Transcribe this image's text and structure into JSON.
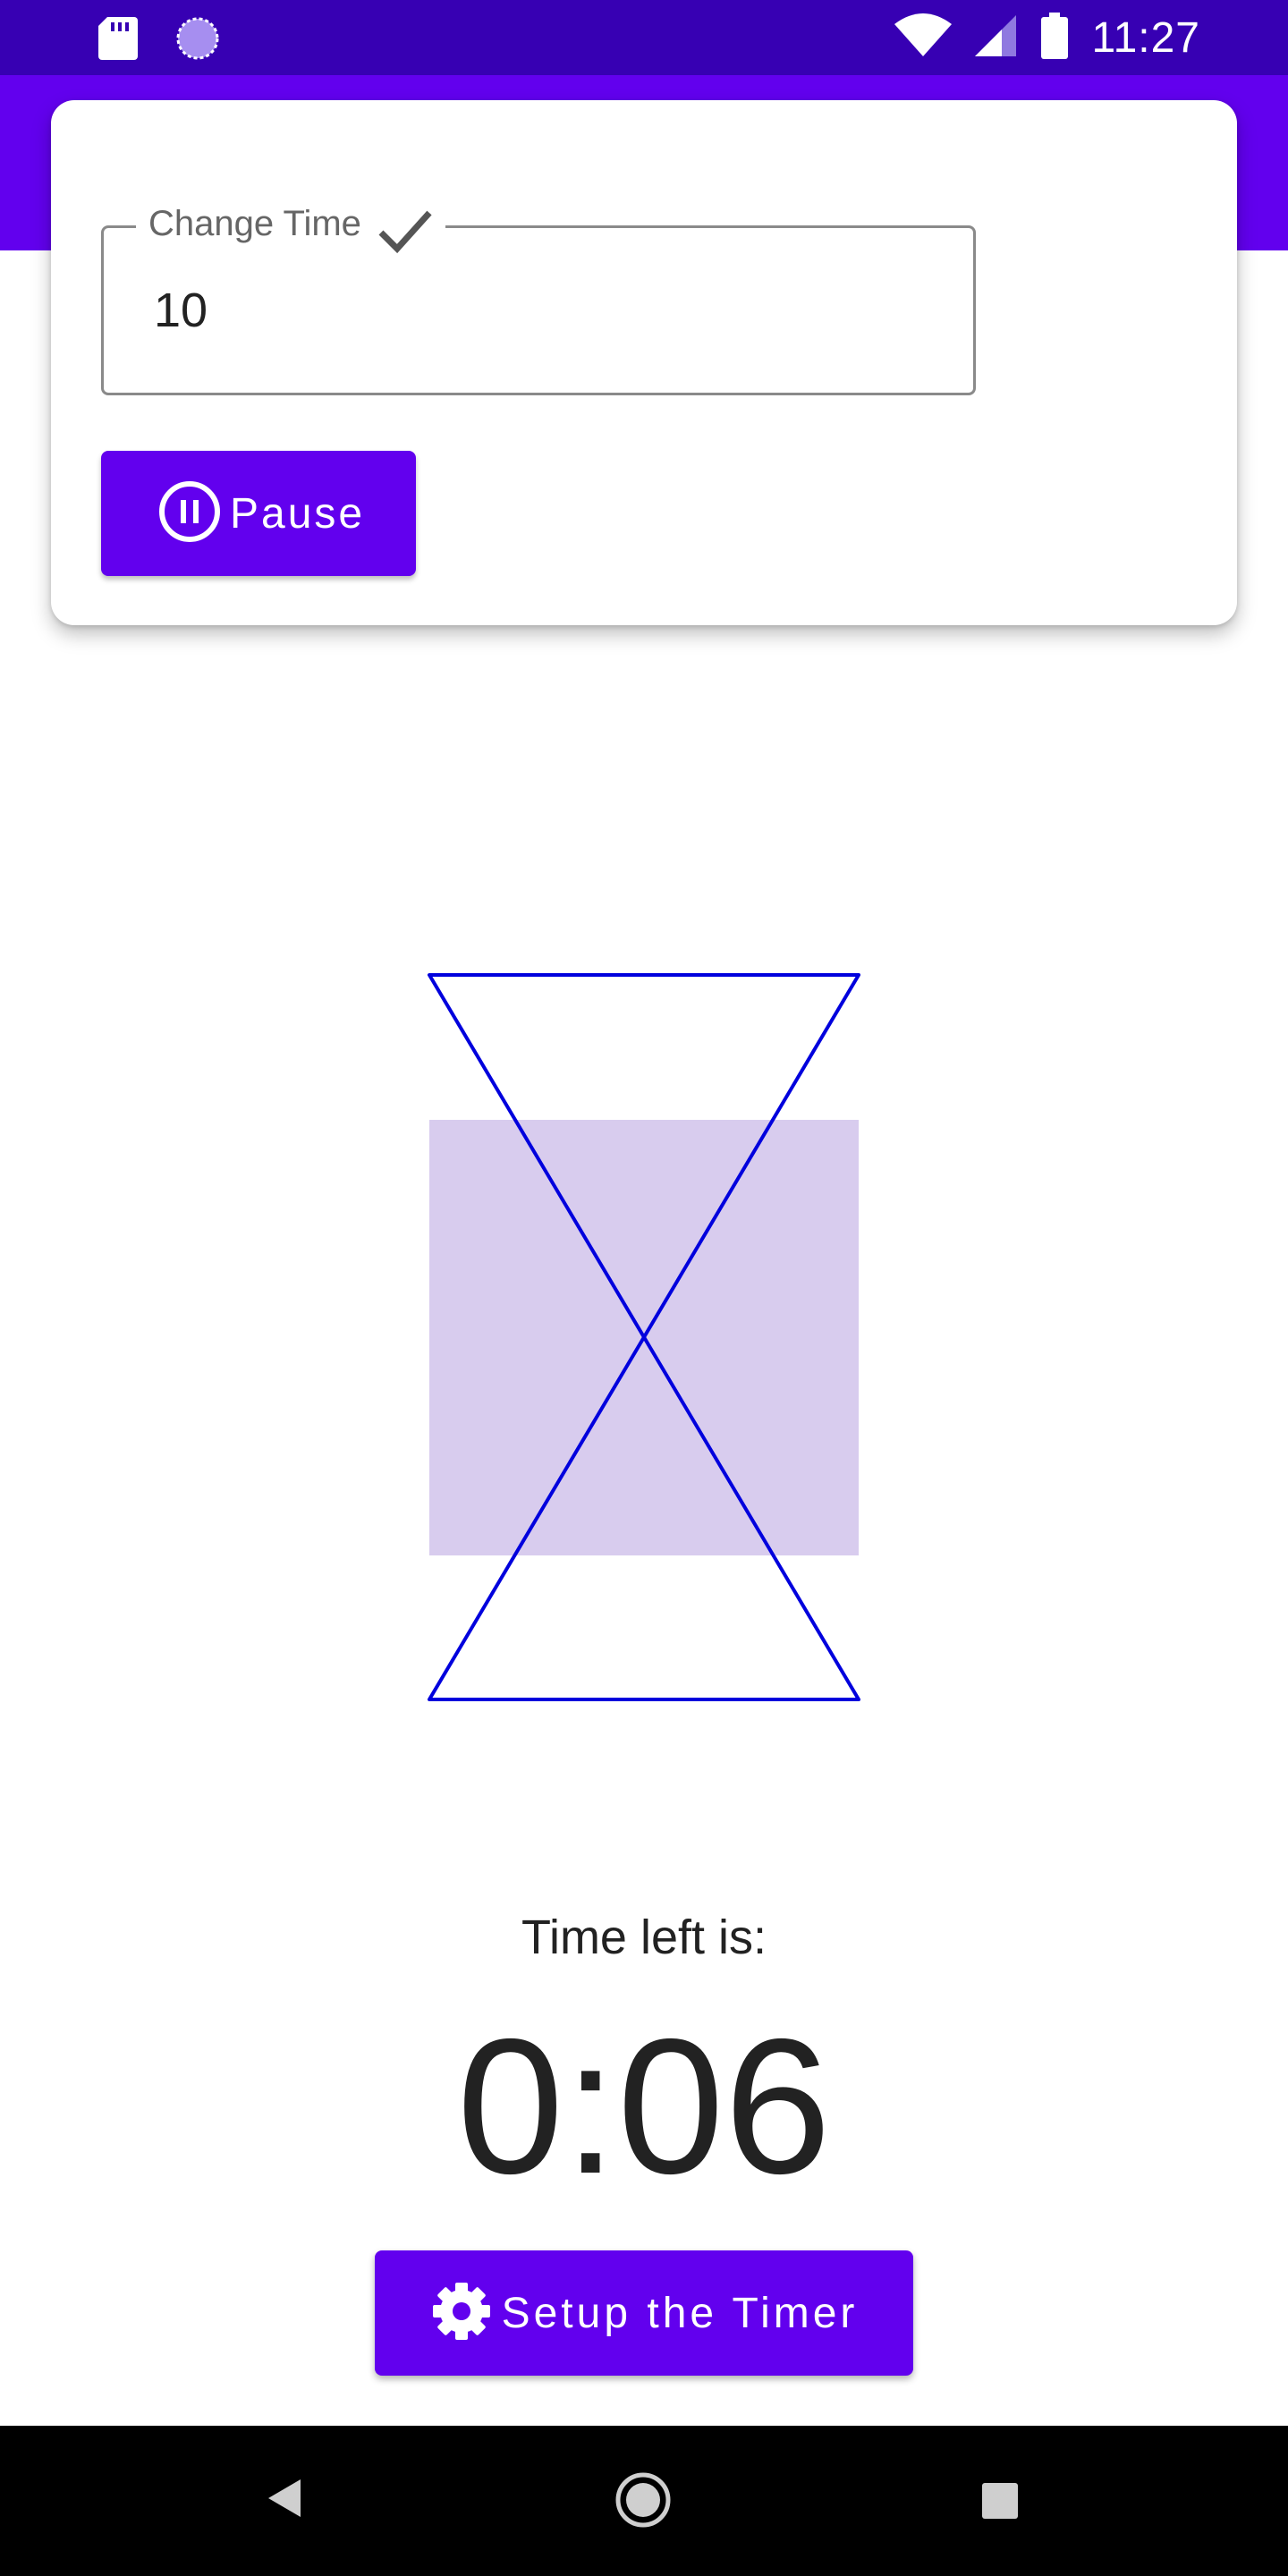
{
  "status_bar": {
    "time": "11:27",
    "left_icons": [
      "sd-card-icon",
      "loading-circle-icon"
    ],
    "right_icons": [
      "wifi-icon",
      "cell-signal-icon",
      "battery-icon"
    ],
    "background_color": "#3700b3"
  },
  "app_bar": {
    "background_color": "#6200ee"
  },
  "card": {
    "field_label": "Change Time",
    "field_value": "10",
    "pause_label": "Pause"
  },
  "timer": {
    "caption": "Time left is:",
    "value": "0:06",
    "setup_label": "Setup the Timer"
  },
  "colors": {
    "accent": "#6200ee",
    "hourglass_stroke": "#0000dd",
    "sand_fill": "#d8ccee"
  },
  "nav_bar": {
    "buttons": [
      "back-icon",
      "home-icon",
      "recents-icon"
    ]
  }
}
